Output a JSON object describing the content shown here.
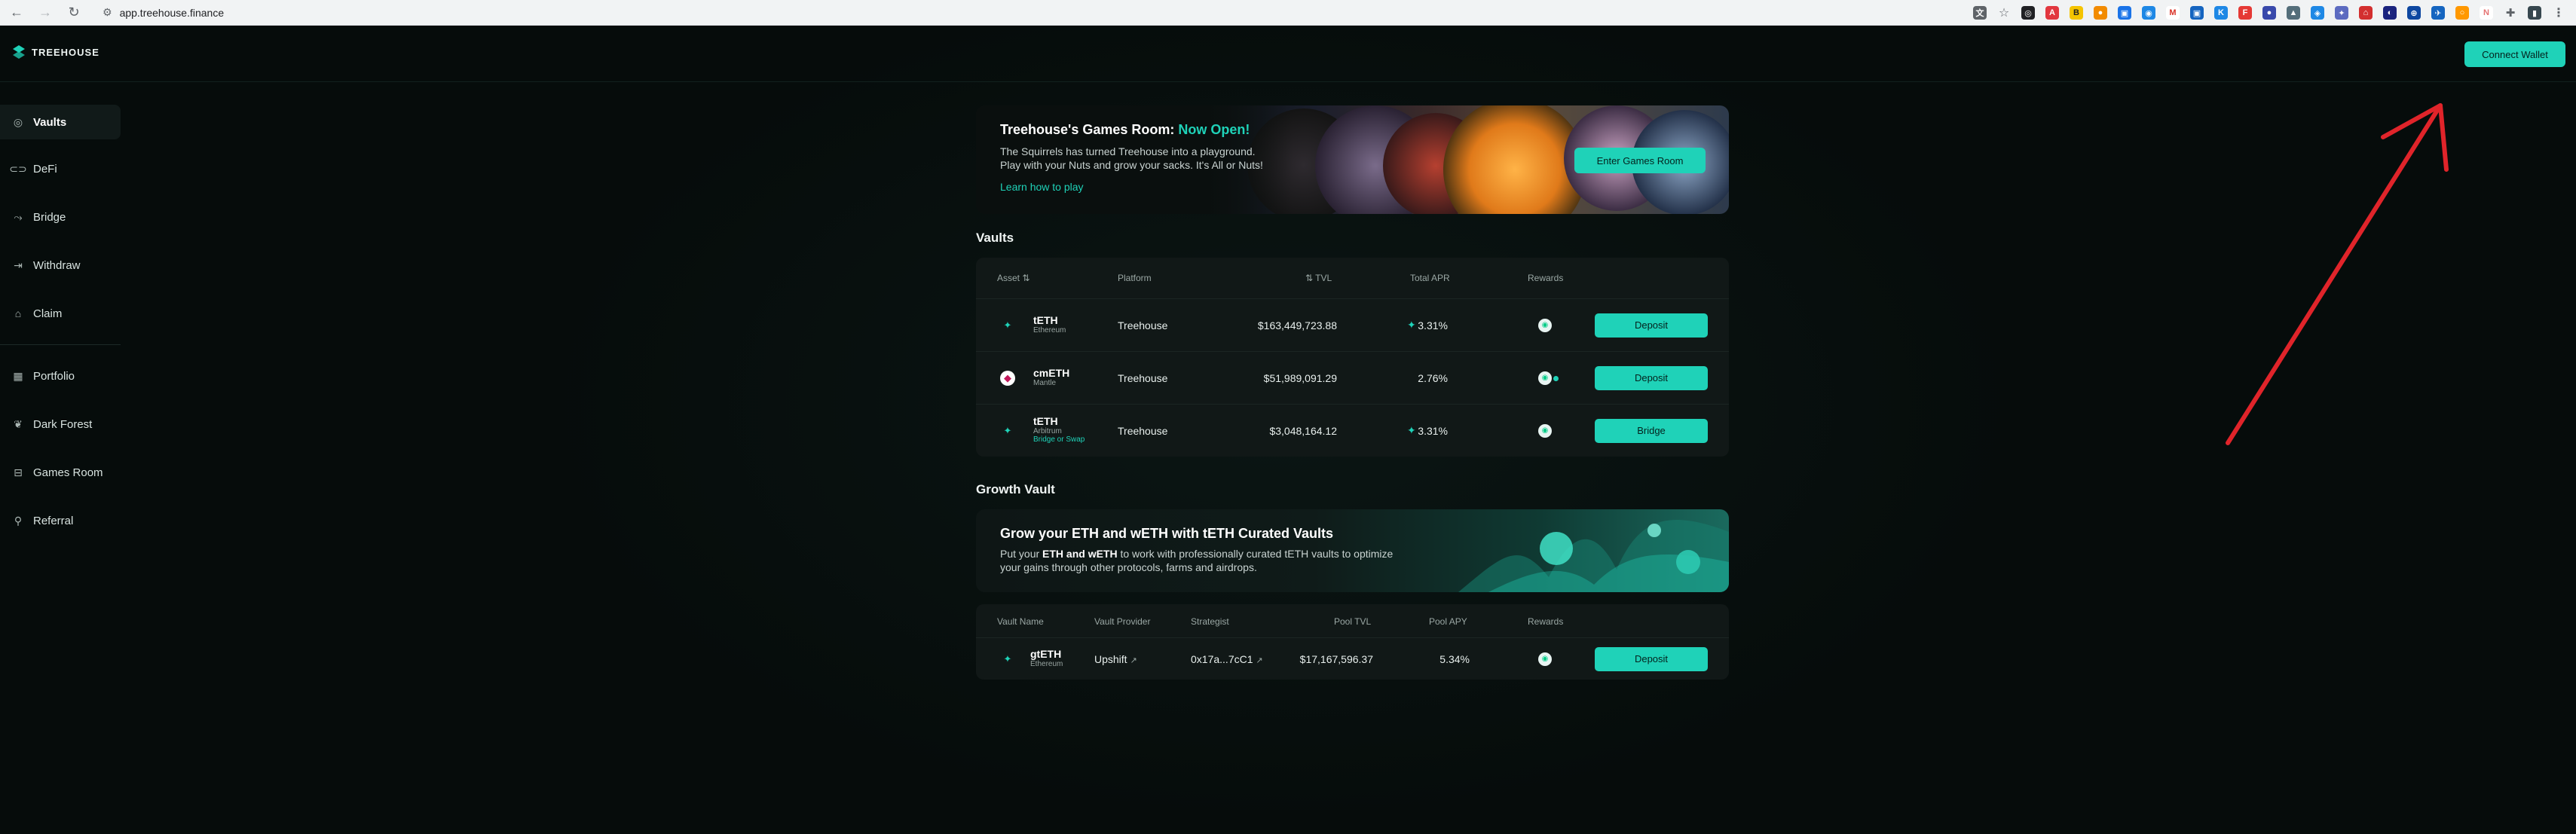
{
  "browser": {
    "url": "app.treehouse.finance"
  },
  "app": {
    "logo_text": "TREEHOUSE",
    "connect_label": "Connect Wallet"
  },
  "sidebar": {
    "items": [
      {
        "label": "Vaults",
        "icon": "vault-icon"
      },
      {
        "label": "DeFi",
        "icon": "link-icon"
      },
      {
        "label": "Bridge",
        "icon": "bridge-icon"
      },
      {
        "label": "Withdraw",
        "icon": "withdraw-icon"
      },
      {
        "label": "Claim",
        "icon": "claim-icon"
      },
      {
        "label": "Portfolio",
        "icon": "grid-icon"
      },
      {
        "label": "Dark Forest",
        "icon": "leaf-icon"
      },
      {
        "label": "Games Room",
        "icon": "gamepad-icon"
      },
      {
        "label": "Referral",
        "icon": "referral-icon"
      }
    ]
  },
  "banner": {
    "title": "Treehouse's Games Room: ",
    "title_accent": "Now Open!",
    "desc_line1": "The Squirrels has turned Treehouse into a playground.",
    "desc_line2": "Play with your Nuts and grow your sacks. It's All or Nuts!",
    "link": "Learn how to play",
    "button": "Enter Games Room"
  },
  "vaults": {
    "title": "Vaults",
    "headers": {
      "asset": "Asset ⇅",
      "platform": "Platform",
      "tvl": "⇅ TVL",
      "apr": "Total APR",
      "rewards": "Rewards"
    },
    "rows": [
      {
        "name": "tETH",
        "network": "Ethereum",
        "sub": "",
        "platform": "Treehouse",
        "tvl": "$163,449,723.88",
        "apr": "3.31%",
        "action": "Deposit"
      },
      {
        "name": "cmETH",
        "network": "Mantle",
        "sub": "",
        "platform": "Treehouse",
        "tvl": "$51,989,091.29",
        "apr": "2.76%",
        "action": "Deposit"
      },
      {
        "name": "tETH",
        "network": "Arbitrum",
        "sub": "Bridge or Swap",
        "platform": "Treehouse",
        "tvl": "$3,048,164.12",
        "apr": "3.31%",
        "action": "Bridge"
      }
    ]
  },
  "growth": {
    "title": "Growth Vault",
    "banner_title": "Grow your ETH and wETH with tETH Curated Vaults",
    "desc_pre": "Put your ",
    "desc_bold": "ETH and wETH",
    "desc_post": " to work with professionally curated tETH vaults to optimize",
    "desc_line2": "your gains through other protocols, farms and airdrops.",
    "headers": {
      "name": "Vault Name",
      "provider": "Vault Provider",
      "strategist": "Strategist",
      "tvl": "Pool TVL",
      "apy": "Pool APY",
      "rewards": "Rewards"
    },
    "rows": [
      {
        "name": "gtETH",
        "network": "Ethereum",
        "provider": "Upshift",
        "strategist": "0x17a...7cC1",
        "tvl": "$17,167,596.37",
        "apy": "5.34%",
        "action": "Deposit"
      }
    ]
  },
  "colors": {
    "accent": "#1fd2b8",
    "annotation": "#e0242a"
  }
}
